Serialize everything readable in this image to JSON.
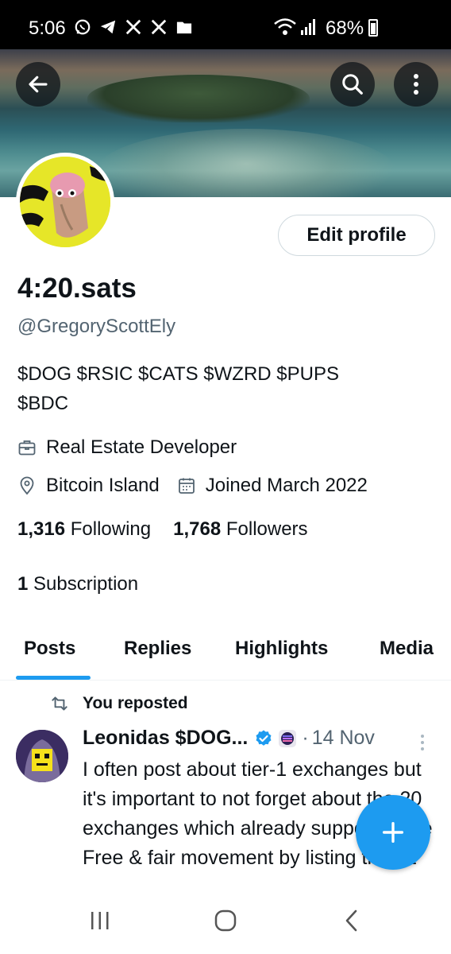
{
  "status_bar": {
    "time": "5:06",
    "battery": "68%",
    "left_icons": [
      "whatsapp-icon",
      "telegram-icon",
      "x-icon",
      "x-icon",
      "folder-icon"
    ],
    "right_icons": [
      "wifi-icon",
      "signal-icon",
      "battery-icon"
    ]
  },
  "header": {
    "back_icon": "arrow-left-icon",
    "search_icon": "search-icon",
    "more_icon": "more-vertical-icon"
  },
  "profile": {
    "edit_label": "Edit profile",
    "display_name": "4:20.sats",
    "handle": "@GregoryScottEly",
    "bio_line1": "$DOG $RSIC $CATS $WZRD $PUPS",
    "bio_line2": "$BDC",
    "profession": "Real Estate Developer",
    "location": "Bitcoin Island",
    "joined": "Joined March 2022",
    "following_count": "1,316",
    "following_label": "Following",
    "followers_count": "1,768",
    "followers_label": "Followers",
    "subscription_count": "1",
    "subscription_label": "Subscription"
  },
  "tabs": [
    {
      "label": "Posts",
      "active": true
    },
    {
      "label": "Replies",
      "active": false
    },
    {
      "label": "Highlights",
      "active": false
    },
    {
      "label": "Media",
      "active": false
    }
  ],
  "post": {
    "repost_label": "You reposted",
    "author_name": "Leonidas $DOG...",
    "time": "14 Nov",
    "text": "I often post about tier-1 exchanges but it's important to not forget about the 20 exchanges which already supported the Free & fair movement by listing the #1"
  },
  "colors": {
    "accent": "#1d9bf0",
    "text": "#0f1419",
    "muted": "#536471"
  }
}
